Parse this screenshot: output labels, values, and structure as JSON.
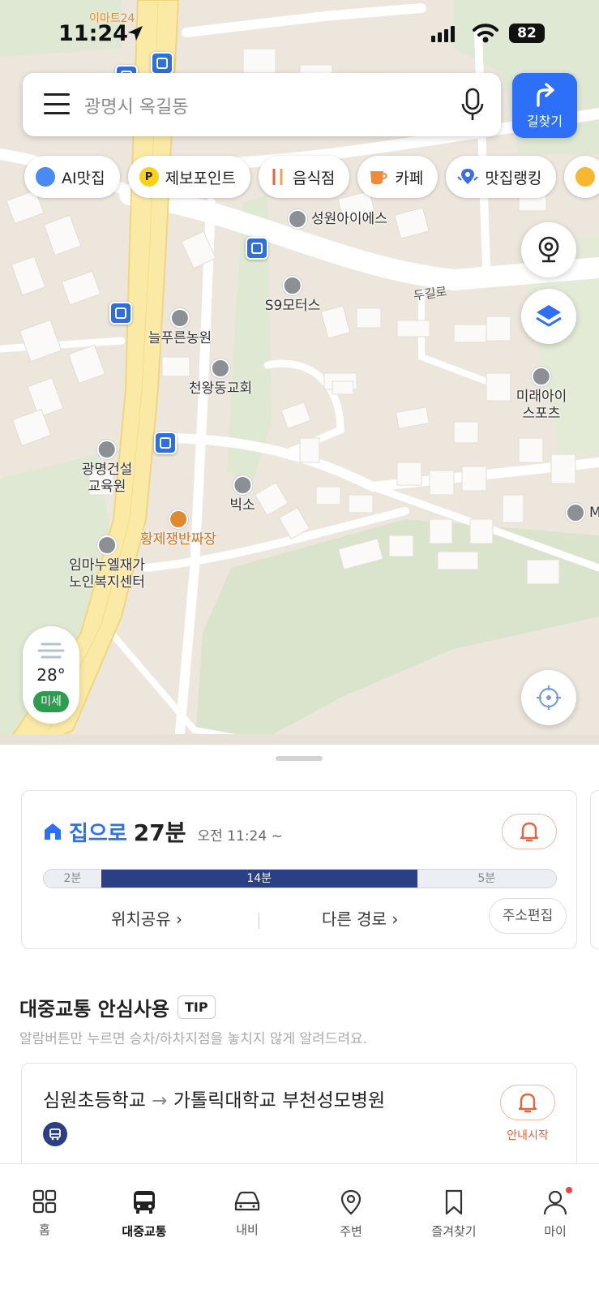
{
  "status_bar": {
    "time": "11:24",
    "battery": "82"
  },
  "search": {
    "text": "광명시 옥길동",
    "route_button": "길찾기"
  },
  "chips": [
    {
      "label": "AI맛집",
      "icon": "ai-compass-icon"
    },
    {
      "label": "제보포인트",
      "icon": "p-point-icon",
      "glyph": "P"
    },
    {
      "label": "음식점",
      "icon": "fork-knife-icon"
    },
    {
      "label": "카페",
      "icon": "coffee-icon"
    },
    {
      "label": "맛집랭킹",
      "icon": "ranking-pin-icon"
    }
  ],
  "map": {
    "road_labels": [
      "두길로"
    ],
    "places": [
      "성원아이에스",
      "S9모터스",
      "늘푸른농원",
      "천왕동교회",
      "미래아이스포츠",
      "광명건설교육원",
      "빅소",
      "황제쟁반짜장",
      "M&S코리",
      "임마누엘재가노인복지센터"
    ],
    "place_lines": {
      "mirae": [
        "미래아이",
        "스포츠"
      ],
      "gwangmyeong": [
        "광명건설",
        "교육원"
      ],
      "immanuel": [
        "임마누엘재가",
        "노인복지센터"
      ]
    },
    "top_partial_label": "이마트24"
  },
  "weather": {
    "temp": "28°",
    "dust": "미세"
  },
  "home_card": {
    "destination": "집으로",
    "duration": "27분",
    "departure": "오전 11:24 ~",
    "segments": [
      "2분",
      "14분",
      "5분"
    ],
    "share": "위치공유",
    "other_route": "다른 경로",
    "edit_address": "주소편집"
  },
  "safe_transit": {
    "title": "대중교통 안심사용",
    "tip": "TIP",
    "description": "알람버튼만 누르면 승차/하차지점을 놓치지 않게 알려드려요.",
    "route_from": "심원초등학교",
    "route_arrow": "→",
    "route_to": "가톨릭대학교 부천성모병원",
    "start_guide": "안내시작"
  },
  "tabs": [
    "홈",
    "대중교통",
    "내비",
    "주변",
    "즐겨찾기",
    "마이"
  ],
  "colors": {
    "accent": "#2d6ff7",
    "navy": "#2b3f86",
    "alert": "#e8623a",
    "dust_good": "#2d9c4e"
  }
}
